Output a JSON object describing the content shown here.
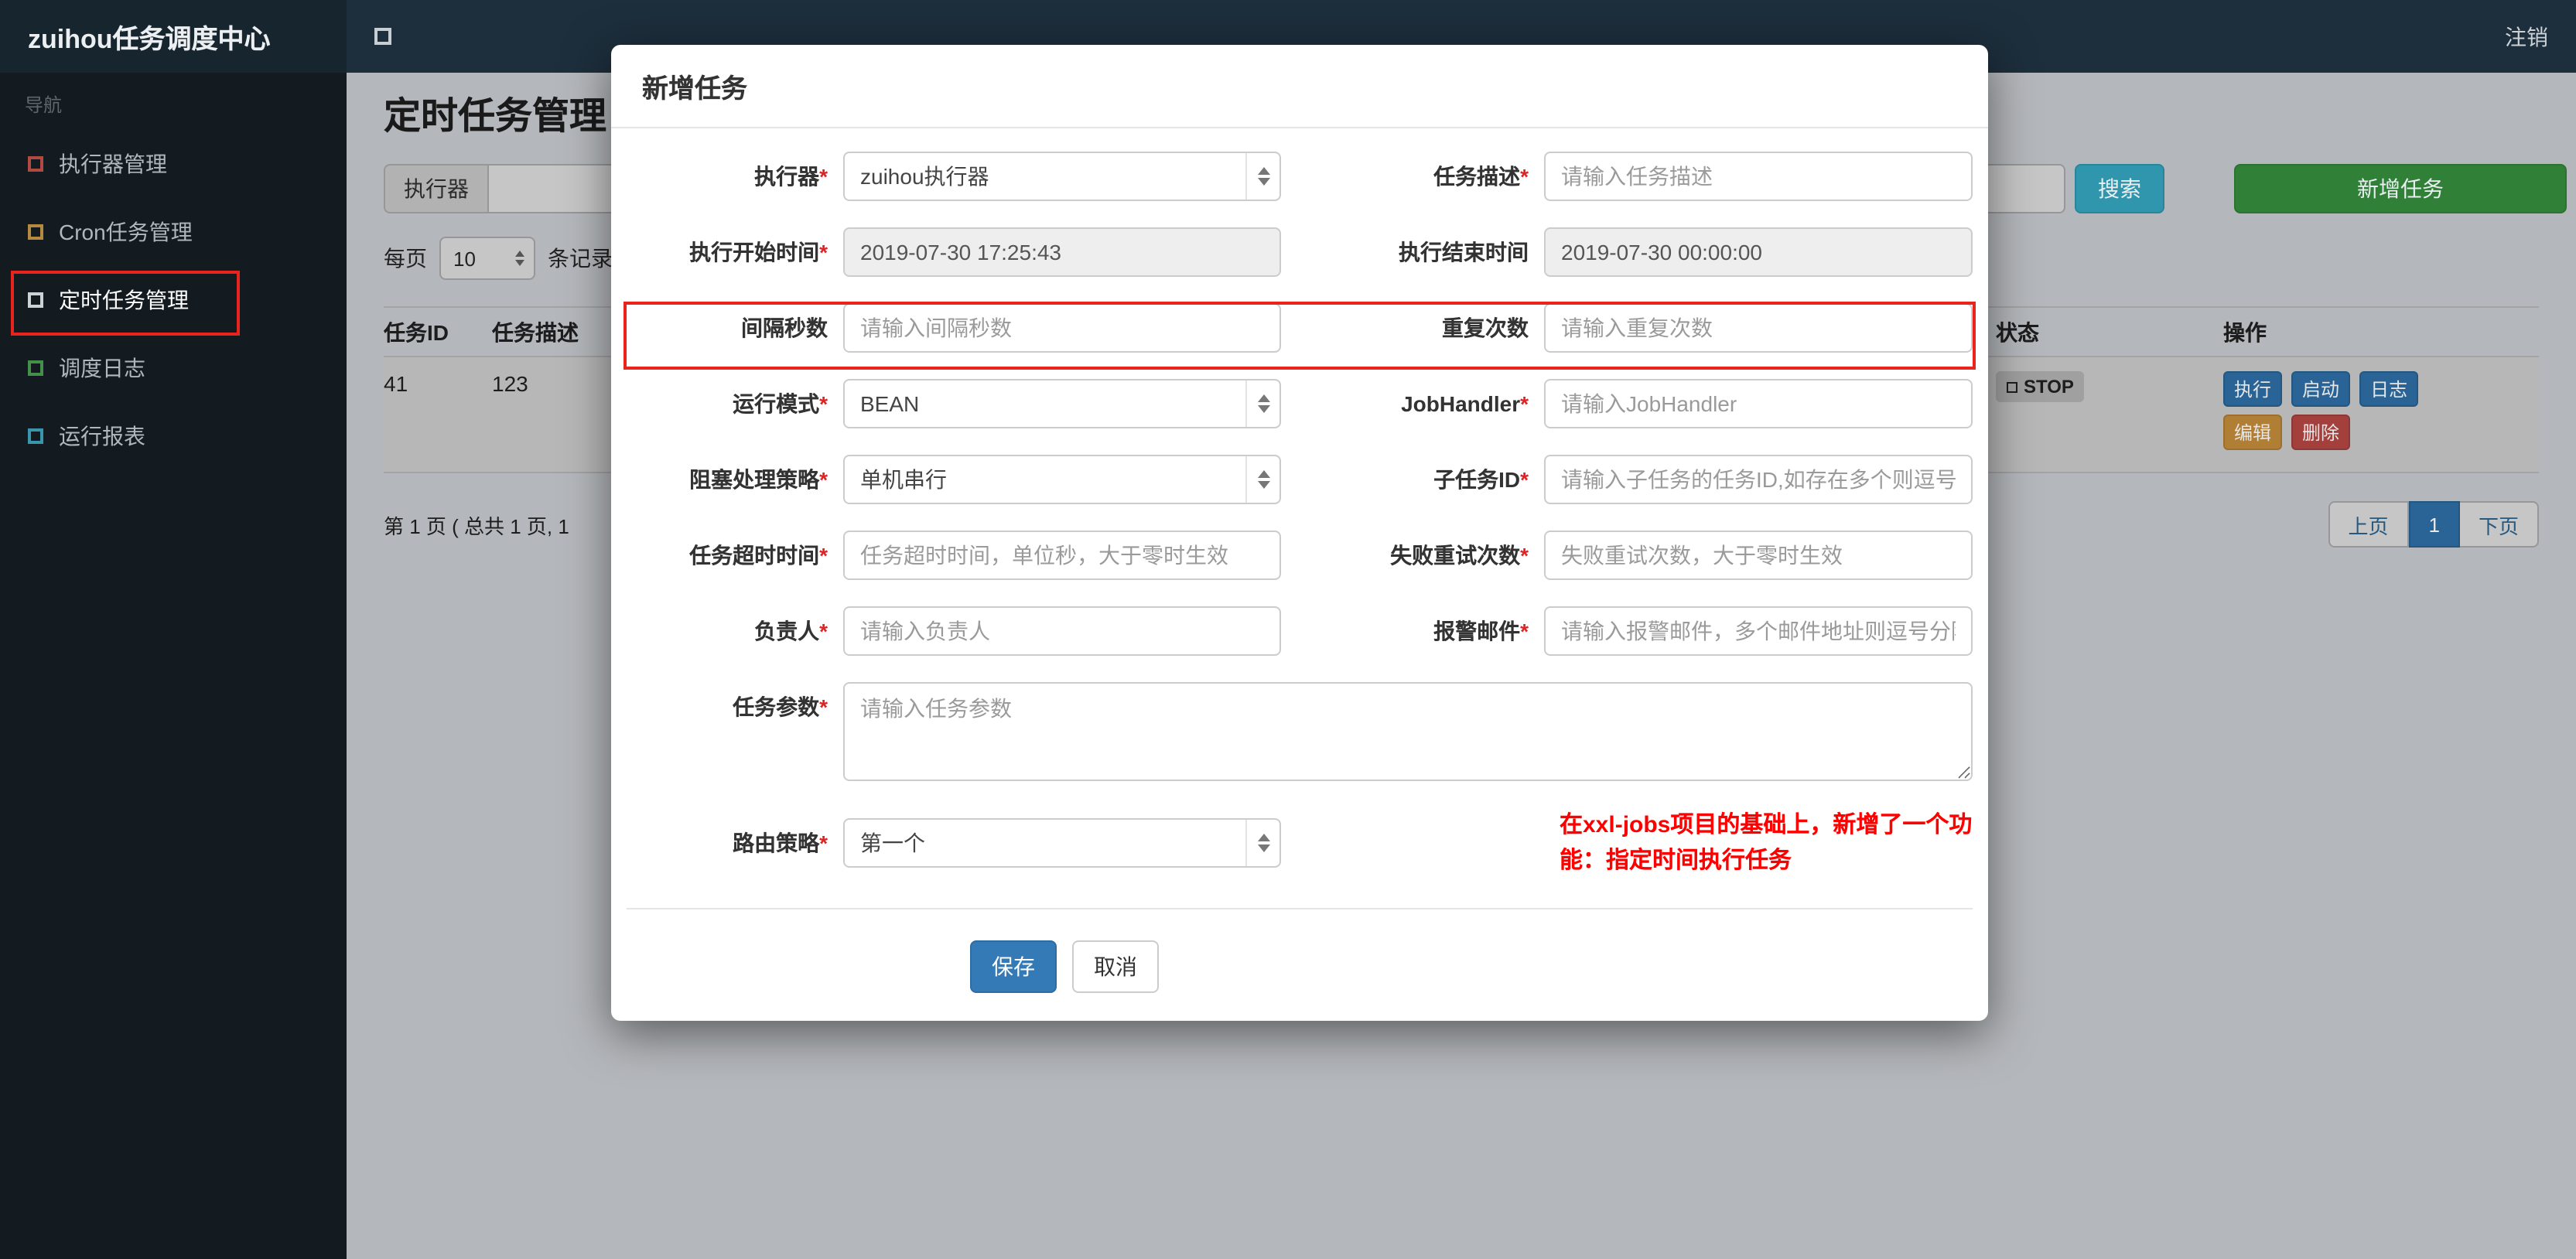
{
  "navbar": {
    "brand": "zuihou任务调度中心",
    "logout": "注销"
  },
  "sidebar": {
    "section": "导航",
    "items": [
      {
        "label": "执行器管理",
        "icon": "square-outline-icon",
        "icon_color": "#b04a43",
        "active": false
      },
      {
        "label": "Cron任务管理",
        "icon": "square-outline-icon",
        "icon_color": "#b5893f",
        "active": false
      },
      {
        "label": "定时任务管理",
        "icon": "square-outline-icon",
        "icon_color": "#cdd2d5",
        "active": true
      },
      {
        "label": "调度日志",
        "icon": "square-outline-icon",
        "icon_color": "#44904a",
        "active": false
      },
      {
        "label": "运行报表",
        "icon": "square-outline-icon",
        "icon_color": "#3a96ad",
        "active": false
      }
    ]
  },
  "page": {
    "title": "定时任务管理",
    "filter": {
      "executor_addon": "执行器",
      "search_button": "搜索",
      "add_button": "新增任务"
    },
    "page_size": {
      "prefix": "每页",
      "value": "10",
      "suffix": "条记录"
    },
    "table": {
      "headers": [
        "任务ID",
        "任务描述",
        "状态",
        "操作"
      ],
      "row": {
        "id": "41",
        "desc": "123",
        "status": "STOP",
        "actions": [
          "执行",
          "启动",
          "日志",
          "编辑",
          "删除"
        ]
      }
    },
    "pagination": {
      "summary": "第 1 页 ( 总共 1 页, 1",
      "prev": "上页",
      "current": "1",
      "next": "下页"
    }
  },
  "modal": {
    "title": "新增任务",
    "required_mark": "*",
    "fields": {
      "executor": {
        "label": "执行器",
        "value": "zuihou执行器"
      },
      "desc": {
        "label": "任务描述",
        "placeholder": "请输入任务描述"
      },
      "start": {
        "label": "执行开始时间",
        "value": "2019-07-30 17:25:43"
      },
      "end": {
        "label": "执行结束时间",
        "value": "2019-07-30 00:00:00"
      },
      "interval": {
        "label": "间隔秒数",
        "placeholder": "请输入间隔秒数"
      },
      "repeat": {
        "label": "重复次数",
        "placeholder": "请输入重复次数"
      },
      "mode": {
        "label": "运行模式",
        "value": "BEAN"
      },
      "handler": {
        "label": "JobHandler",
        "placeholder": "请输入JobHandler"
      },
      "block": {
        "label": "阻塞处理策略",
        "value": "单机串行"
      },
      "child": {
        "label": "子任务ID",
        "placeholder": "请输入子任务的任务ID,如存在多个则逗号分隔"
      },
      "timeout": {
        "label": "任务超时时间",
        "placeholder": "任务超时时间，单位秒，大于零时生效"
      },
      "retry": {
        "label": "失败重试次数",
        "placeholder": "失败重试次数，大于零时生效"
      },
      "owner": {
        "label": "负责人",
        "placeholder": "请输入负责人"
      },
      "email": {
        "label": "报警邮件",
        "placeholder": "请输入报警邮件，多个邮件地址则逗号分隔"
      },
      "params": {
        "label": "任务参数",
        "placeholder": "请输入任务参数"
      },
      "route": {
        "label": "路由策略",
        "value": "第一个"
      }
    },
    "note": "在xxl-jobs项目的基础上，新增了一个功能：指定时间执行任务",
    "save_button": "保存",
    "cancel_button": "取消"
  },
  "colors": {
    "save_blue": "#337ab7",
    "search_teal": "#2f96ad",
    "add_green": "#308038",
    "annotation_red": "#e8241d",
    "note_red": "#ff0000",
    "action_blue": "#2a6496",
    "action_orange": "#b07f35",
    "action_red": "#a33f3c"
  }
}
